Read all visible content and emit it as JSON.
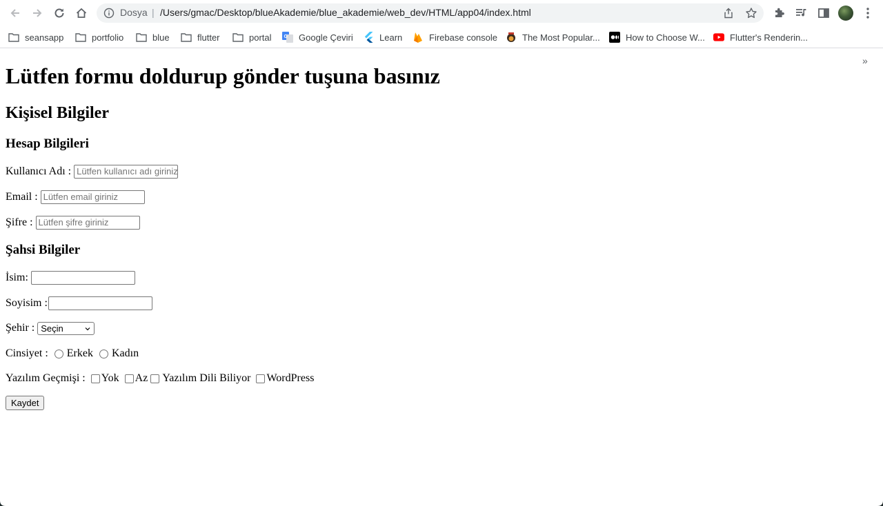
{
  "browser": {
    "scheme_label": "Dosya",
    "url": "/Users/gmac/Desktop/blueAkademie/blue_akademie/web_dev/HTML/app04/index.html",
    "bookmarks": [
      {
        "label": "seansapp",
        "icon": "folder-icon"
      },
      {
        "label": "portfolio",
        "icon": "folder-icon"
      },
      {
        "label": "blue",
        "icon": "folder-icon"
      },
      {
        "label": "flutter",
        "icon": "folder-icon"
      },
      {
        "label": "portal",
        "icon": "folder-icon"
      },
      {
        "label": "Google Çeviri",
        "icon": "google-translate-icon"
      },
      {
        "label": "Learn",
        "icon": "flutter-icon"
      },
      {
        "label": "Firebase console",
        "icon": "firebase-icon"
      },
      {
        "label": "The Most Popular...",
        "icon": "site-icon"
      },
      {
        "label": "How to Choose W...",
        "icon": "medium-icon"
      },
      {
        "label": "Flutter's Renderin...",
        "icon": "youtube-icon"
      }
    ],
    "overflow_label": "»"
  },
  "page": {
    "heading": "Lütfen formu doldurup gönder tuşuna basınız",
    "section_personal": "Kişisel Bilgiler",
    "section_account": "Hesap Bilgileri",
    "section_private": "Şahsi Bilgiler",
    "fields": {
      "username_label": "Kullanıcı Adı :",
      "username_placeholder": "Lütfen kullanıcı adı giriniz",
      "email_label": "Email :",
      "email_placeholder": "Lütfen email giriniz",
      "password_label": "Şifre :",
      "password_placeholder": "Lütfen şifre  giriniz",
      "name_label": "İsim:",
      "surname_label": "Soyisim :",
      "city_label": "Şehir :",
      "city_selected": "Seçin",
      "gender_label": "Cinsiyet :",
      "gender_options": [
        "Erkek",
        "Kadın"
      ],
      "experience_label": "Yazılım Geçmişi :",
      "experience_options": [
        "Yok",
        "Az",
        "Yazılım Dili Biliyor",
        "WordPress"
      ]
    },
    "submit_label": "Kaydet"
  }
}
